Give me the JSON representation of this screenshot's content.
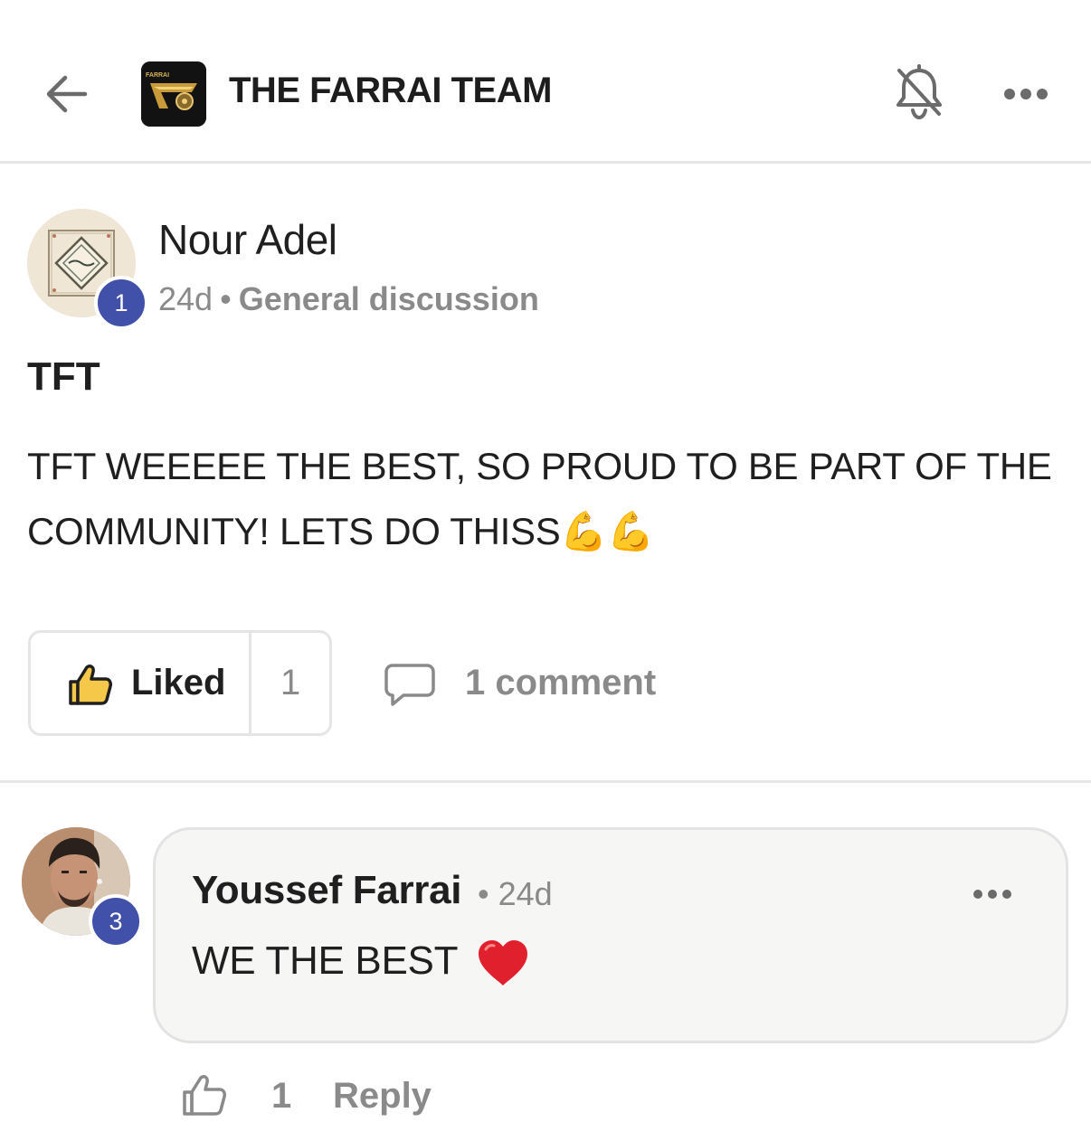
{
  "header": {
    "title": "THE FARRAI TEAM",
    "logo_text": "FARRAI",
    "back_icon": "arrow-left-icon",
    "bell_icon": "bell-off-icon",
    "more_icon": "more-horizontal-icon"
  },
  "post": {
    "author": "Nour Adel",
    "author_badge": "1",
    "time": "24d",
    "separator": "•",
    "channel": "General discussion",
    "title": "TFT",
    "body": "TFT WEEEEE THE BEST, SO PROUD TO BE PART OF THE COMMUNITY! LETS DO THISS",
    "body_emoji": "💪💪",
    "like_label": "Liked",
    "like_count": "1",
    "comment_label": "1 comment"
  },
  "comment": {
    "author": "Youssef Farrai",
    "author_badge": "3",
    "time": "• 24d",
    "text": "WE THE BEST",
    "emoji": "❤️",
    "like_count": "1",
    "reply_label": "Reply"
  },
  "colors": {
    "badge": "#4150a8",
    "muted_text": "#8a8a8a",
    "divider": "#e6e6e6",
    "comment_bg": "#f6f6f5",
    "heart": "#e0202c"
  }
}
